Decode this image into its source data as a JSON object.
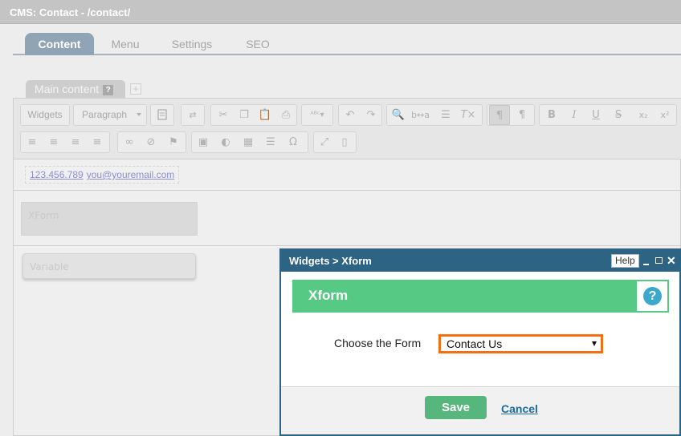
{
  "cms": {
    "title": "CMS: Contact - /contact/",
    "tabs": [
      "Content",
      "Menu",
      "Settings",
      "SEO"
    ],
    "active_tab": "Content",
    "content_tab": {
      "label": "Main content",
      "help": "?",
      "add": "+"
    }
  },
  "toolbar": {
    "widgets_label": "Widgets",
    "format_label": "Paragraph",
    "row1_icons": [
      "templates-icon",
      "spell-direction-icon",
      "cut-icon",
      "copy-icon",
      "paste-icon",
      "print-icon",
      "spellcheck-icon",
      "undo-icon",
      "redo-icon",
      "find-icon",
      "replace-icon",
      "select-all-icon",
      "remove-format-icon",
      "ltr-icon",
      "rtl-icon",
      "bold-icon",
      "italic-icon",
      "underline-icon",
      "strike-icon",
      "subscript-icon",
      "superscript-icon"
    ],
    "row2_icons": [
      "align-left-icon",
      "align-center-icon",
      "align-right-icon",
      "justify-icon",
      "link-icon",
      "unlink-icon",
      "anchor-icon",
      "image-icon",
      "flash-icon",
      "table-icon",
      "horizontal-rule-icon",
      "special-char-icon",
      "maximize-icon",
      "show-blocks-icon"
    ],
    "glyphs": {
      "bold": "B",
      "italic": "I",
      "underline": "U",
      "strike": "S",
      "subscript": "x₂",
      "superscript": "x²",
      "special": "Ω",
      "ltr": "¶",
      "rtl": "¶"
    }
  },
  "content": {
    "phone": "123.456.789",
    "email": "you@youremail.com",
    "xform_block": "XForm",
    "variable_block": "Variable"
  },
  "dialog": {
    "title": "Widgets > Xform",
    "help_label": "Help",
    "minimize": "_",
    "close": "✕",
    "section_title": "Xform",
    "section_help": "?",
    "form_label": "Choose the Form",
    "selected_form": "Contact Us",
    "save_label": "Save",
    "cancel_label": "Cancel"
  },
  "colors": {
    "dialog_border": "#2e6483",
    "section_green": "#56c985",
    "save_green": "#56b67c",
    "select_highlight": "#f36f12",
    "help_circle": "#3ba8cc",
    "cancel_link": "#1a6ca0"
  }
}
